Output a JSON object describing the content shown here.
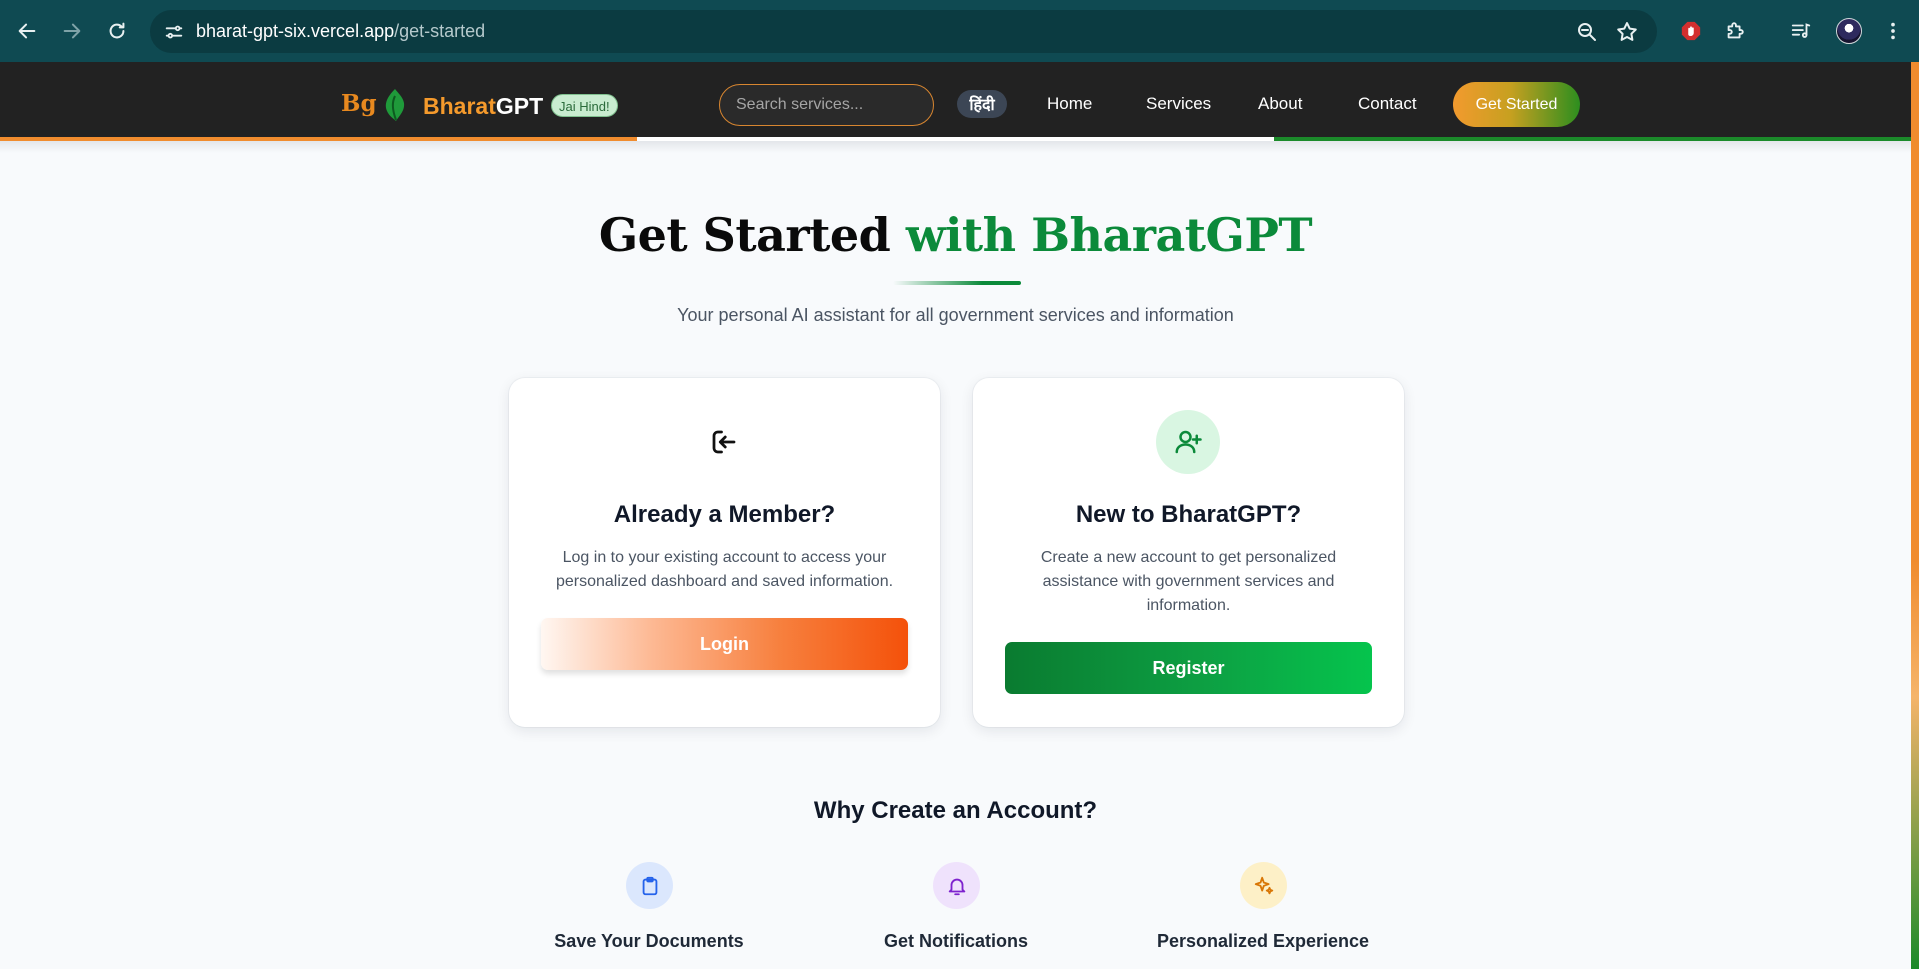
{
  "browser": {
    "url_host": "bharat-gpt-six.vercel.app",
    "url_path": "/get-started",
    "icons": [
      "back-icon",
      "forward-icon",
      "reload-icon",
      "site-info-icon",
      "zoom-icon",
      "bookmark-star-icon",
      "extension-stop-icon",
      "extensions-puzzle-icon",
      "media-queue-icon",
      "avatar",
      "menu-kebab-icon"
    ]
  },
  "navbar": {
    "logo_mark": "Bg",
    "brand_first": "Bharat",
    "brand_second": "GPT",
    "badge": "Jai Hind!",
    "search_placeholder": "Search services...",
    "language_toggle": "हिंदी",
    "links": [
      "Home",
      "Services",
      "About",
      "Contact"
    ],
    "cta": "Get Started"
  },
  "hero": {
    "title_plain": "Get Started ",
    "title_accent": "with BharatGPT",
    "subtitle": "Your personal AI assistant for all government services and information"
  },
  "cards": {
    "login": {
      "icon": "login-arrow-icon",
      "title": "Already a Member?",
      "description": "Log in to your existing account to access your personalized dashboard and saved information.",
      "button": "Login"
    },
    "register": {
      "icon": "user-plus-icon",
      "title": "New to BharatGPT?",
      "description": "Create a new account to get personalized assistance with government services and information.",
      "button": "Register"
    }
  },
  "why": {
    "title": "Why Create an Account?",
    "features": [
      {
        "label": "Save Your Documents",
        "icon": "clipboard-icon"
      },
      {
        "label": "Get Notifications",
        "icon": "bell-icon"
      },
      {
        "label": "Personalized Experience",
        "icon": "sparkles-icon"
      }
    ]
  },
  "colors": {
    "chrome": "#0f4a52",
    "navbar": "#222222",
    "saffron": "#f08c2e",
    "india_green": "#1b8a2a",
    "accent_green": "#0b8a3a"
  }
}
